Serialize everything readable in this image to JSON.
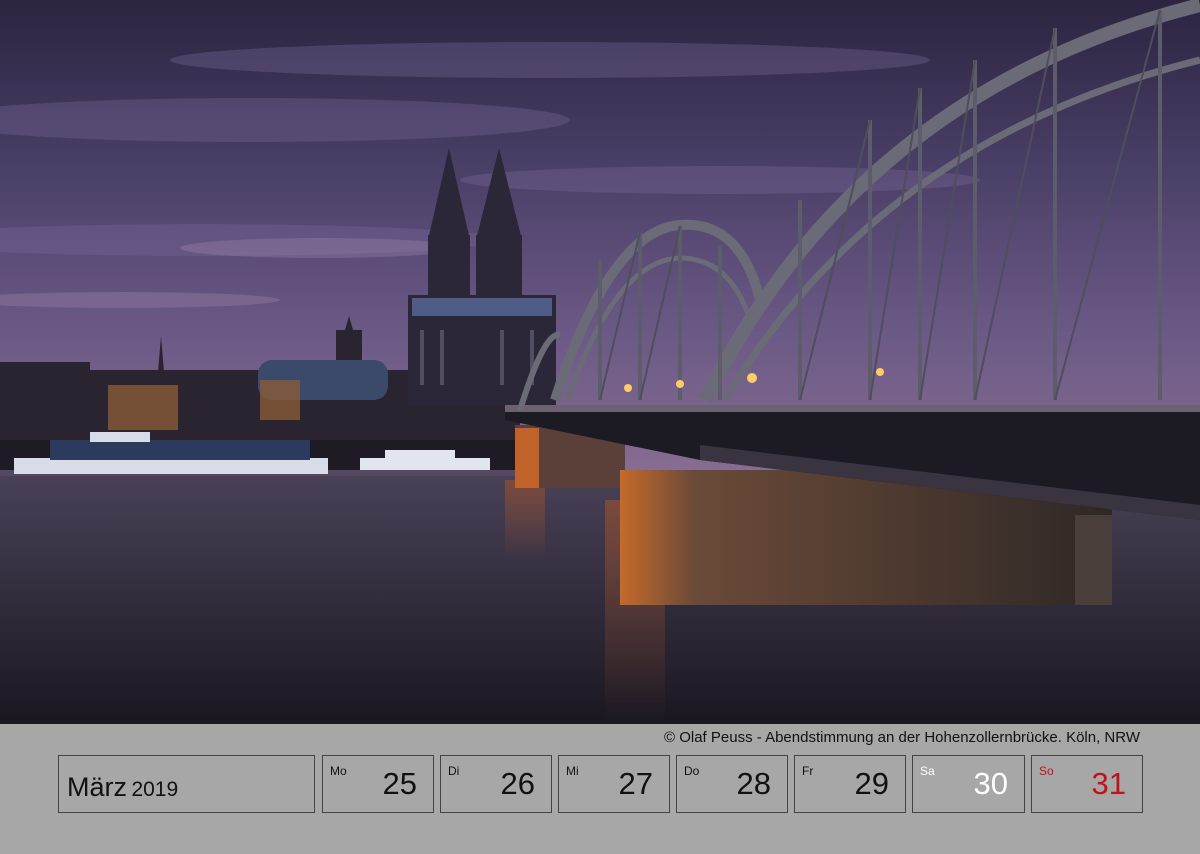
{
  "caption": "© Olaf Peuss - Abendstimmung an der Hohenzollernbrücke. Köln, NRW",
  "month": {
    "name": "März",
    "year": "2019"
  },
  "days": [
    {
      "weekday": "Mo",
      "number": "25"
    },
    {
      "weekday": "Di",
      "number": "26"
    },
    {
      "weekday": "Mi",
      "number": "27"
    },
    {
      "weekday": "Do",
      "number": "28"
    },
    {
      "weekday": "Fr",
      "number": "29"
    },
    {
      "weekday": "Sa",
      "number": "30"
    },
    {
      "weekday": "So",
      "number": "31"
    }
  ],
  "colors": {
    "strip": "#a7a7a7",
    "saturday": "#ffffff",
    "sunday": "#c1121a"
  }
}
